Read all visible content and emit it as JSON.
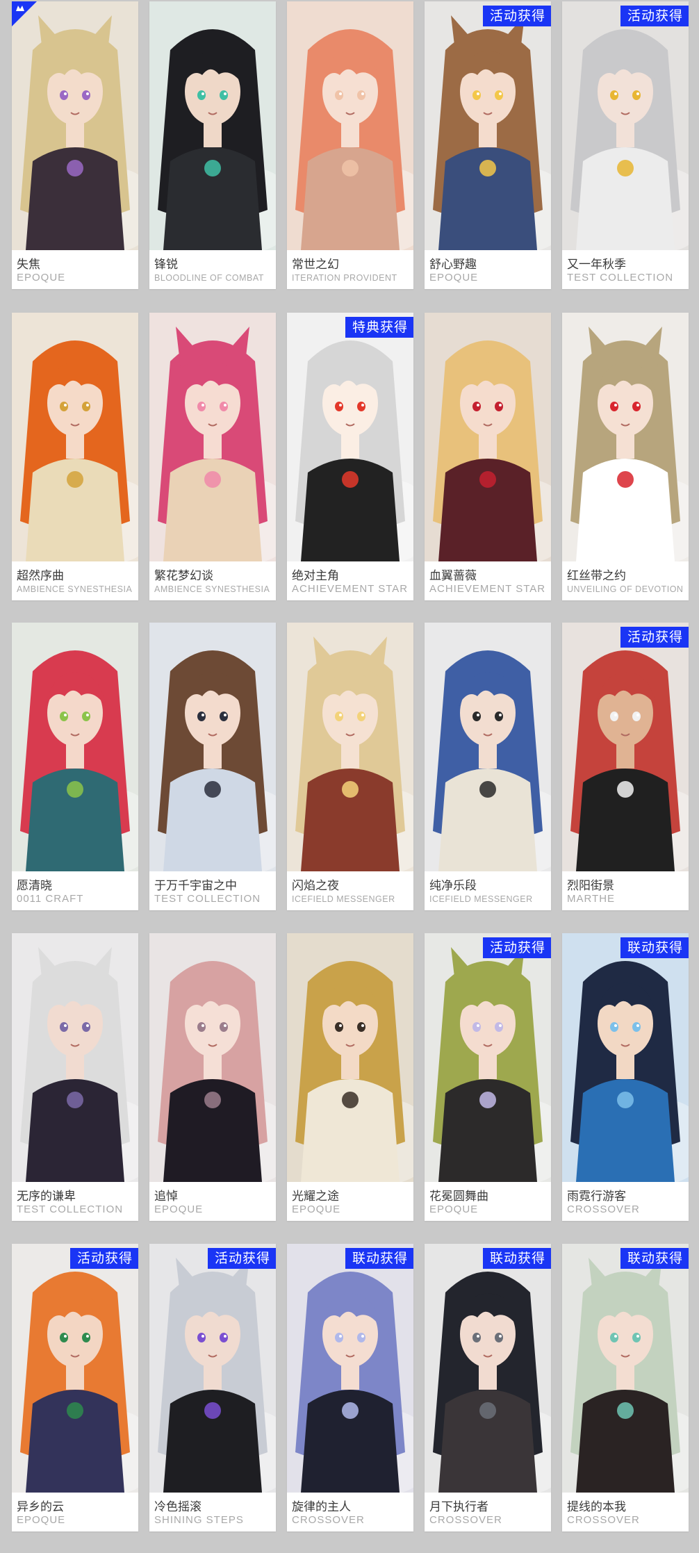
{
  "badge_color": "#1a35f5",
  "cards": [
    {
      "name": "失焦",
      "brand": "EPOQUE",
      "badge": "",
      "corner_icon": "crown-logo-icon",
      "bg": "#e9e2d6",
      "hair": "#d8c48f",
      "skin": "#f3dccb",
      "outfit": "#3b2f3a",
      "accent": "#9a68c4"
    },
    {
      "name": "锋锐",
      "brand": "BLOODLINE OF COMBAT",
      "badge": "",
      "corner_icon": "",
      "bg": "#dfe8e4",
      "hair": "#1e1e22",
      "skin": "#efd8c8",
      "outfit": "#2a2c30",
      "accent": "#3fbfa4"
    },
    {
      "name": "常世之幻",
      "brand": "ITERATION PROVIDENT",
      "badge": "",
      "corner_icon": "",
      "bg": "#efdcd0",
      "hair": "#e98a6a",
      "skin": "#f6dfd2",
      "outfit": "#d7a58e",
      "accent": "#f0c3a8"
    },
    {
      "name": "舒心野趣",
      "brand": "EPOQUE",
      "badge": "活动获得",
      "corner_icon": "",
      "bg": "#e7e6e4",
      "hair": "#9c6b45",
      "skin": "#f4dccd",
      "outfit": "#3a4e7c",
      "accent": "#f3c74a"
    },
    {
      "name": "又一年秋季",
      "brand": "TEST COLLECTION",
      "badge": "活动获得",
      "corner_icon": "",
      "bg": "#e3e1df",
      "hair": "#c9c9cb",
      "skin": "#f2e1d8",
      "outfit": "#ececec",
      "accent": "#e8b633"
    },
    {
      "name": "超然序曲",
      "brand": "AMBIENCE SYNESTHESIA",
      "badge": "",
      "corner_icon": "",
      "bg": "#ede4d7",
      "hair": "#e4661e",
      "skin": "#f5dac8",
      "outfit": "#eadbb8",
      "accent": "#d4a23a"
    },
    {
      "name": "繁花梦幻谈",
      "brand": "AMBIENCE SYNESTHESIA",
      "badge": "",
      "corner_icon": "",
      "bg": "#efe2df",
      "hair": "#d94a77",
      "skin": "#f6dcd2",
      "outfit": "#ead2b6",
      "accent": "#f08aa9"
    },
    {
      "name": "绝对主角",
      "brand": "ACHIEVEMENT STAR",
      "badge": "特典获得",
      "corner_icon": "",
      "bg": "#f1f1f1",
      "hair": "#d6d6d6",
      "skin": "#fbeee4",
      "outfit": "#222222",
      "accent": "#e3382a"
    },
    {
      "name": "血翼蔷薇",
      "brand": "ACHIEVEMENT STAR",
      "badge": "",
      "corner_icon": "",
      "bg": "#e6dcd2",
      "hair": "#e8c17b",
      "skin": "#f5dccd",
      "outfit": "#5a2128",
      "accent": "#c4202f"
    },
    {
      "name": "红丝带之约",
      "brand": "UNVEILING OF DEVOTION",
      "badge": "",
      "corner_icon": "",
      "bg": "#efece8",
      "hair": "#b7a57d",
      "skin": "#f5e0d3",
      "outfit": "#ffffff",
      "accent": "#d8252d"
    },
    {
      "name": "愿清晓",
      "brand": "0011 CRAFT",
      "badge": "",
      "corner_icon": "",
      "bg": "#e4e8e2",
      "hair": "#d83b4f",
      "skin": "#f4d8ca",
      "outfit": "#2f6a73",
      "accent": "#8bc34a"
    },
    {
      "name": "于万千宇宙之中",
      "brand": "TEST COLLECTION",
      "badge": "",
      "corner_icon": "",
      "bg": "#e0e4ea",
      "hair": "#6d4a35",
      "skin": "#f3dbcd",
      "outfit": "#cfd8e5",
      "accent": "#2b2f3d"
    },
    {
      "name": "闪焰之夜",
      "brand": "ICEFIELD MESSENGER",
      "badge": "",
      "corner_icon": "",
      "bg": "#ece4d8",
      "hair": "#e0c997",
      "skin": "#f5e1d2",
      "outfit": "#8a3b2c",
      "accent": "#f3d27a"
    },
    {
      "name": "纯净乐段",
      "brand": "ICEFIELD MESSENGER",
      "badge": "",
      "corner_icon": "",
      "bg": "#e9e9ea",
      "hair": "#3f5fa5",
      "skin": "#f2ddd0",
      "outfit": "#e9e3d6",
      "accent": "#2a2a2a"
    },
    {
      "name": "烈阳街景",
      "brand": "MARTHE",
      "badge": "活动获得",
      "corner_icon": "",
      "bg": "#e8e2de",
      "hair": "#c5433c",
      "skin": "#e0b393",
      "outfit": "#202020",
      "accent": "#f2f2f2"
    },
    {
      "name": "无序的谦卑",
      "brand": "TEST COLLECTION",
      "badge": "",
      "corner_icon": "",
      "bg": "#eae9ea",
      "hair": "#dcdcdc",
      "skin": "#f1dbd0",
      "outfit": "#2b2535",
      "accent": "#7b6aa7"
    },
    {
      "name": "追悼",
      "brand": "EPOQUE",
      "badge": "",
      "corner_icon": "",
      "bg": "#e9e4e4",
      "hair": "#d7a2a2",
      "skin": "#f5dfd6",
      "outfit": "#1f1b24",
      "accent": "#9b7d8c"
    },
    {
      "name": "光耀之途",
      "brand": "EPOQUE",
      "badge": "",
      "corner_icon": "",
      "bg": "#e4dccd",
      "hair": "#c9a24a",
      "skin": "#f3dac6",
      "outfit": "#efe7d6",
      "accent": "#3a2f27"
    },
    {
      "name": "花冕圆舞曲",
      "brand": "EPOQUE",
      "badge": "活动获得",
      "corner_icon": "",
      "bg": "#e7e8e5",
      "hair": "#9ea84e",
      "skin": "#f4dccf",
      "outfit": "#2c2a2a",
      "accent": "#c2b9e6"
    },
    {
      "name": "雨霓行游客",
      "brand": "CROSSOVER",
      "badge": "联动获得",
      "corner_icon": "",
      "bg": "#cfe0ef",
      "hair": "#1f2a44",
      "skin": "#f2d8c4",
      "outfit": "#2a6fb4",
      "accent": "#7cc0ea"
    },
    {
      "name": "异乡的云",
      "brand": "EPOQUE",
      "badge": "活动获得",
      "corner_icon": "",
      "bg": "#eceae8",
      "hair": "#e87a32",
      "skin": "#f3d6c3",
      "outfit": "#33335a",
      "accent": "#2e8b4e"
    },
    {
      "name": "冷色摇滚",
      "brand": "SHINING STEPS",
      "badge": "活动获得",
      "corner_icon": "",
      "bg": "#e6e6e8",
      "hair": "#c8ccd4",
      "skin": "#f0dbd0",
      "outfit": "#1e1e22",
      "accent": "#7a4fd1"
    },
    {
      "name": "旋律的主人",
      "brand": "CROSSOVER",
      "badge": "联动获得",
      "corner_icon": "",
      "bg": "#e2e1ea",
      "hair": "#7d86c8",
      "skin": "#f4ddd1",
      "outfit": "#1f2130",
      "accent": "#b0b8ea"
    },
    {
      "name": "月下执行者",
      "brand": "CROSSOVER",
      "badge": "联动获得",
      "corner_icon": "",
      "bg": "#e6e6e6",
      "hair": "#23252d",
      "skin": "#f1dbd0",
      "outfit": "#3a3538",
      "accent": "#6b6f78"
    },
    {
      "name": "提线的本我",
      "brand": "CROSSOVER",
      "badge": "联动获得",
      "corner_icon": "",
      "bg": "#e5e6e3",
      "hair": "#c3d2bf",
      "skin": "#f3ddd1",
      "outfit": "#2a2323",
      "accent": "#6fc4b3"
    }
  ]
}
